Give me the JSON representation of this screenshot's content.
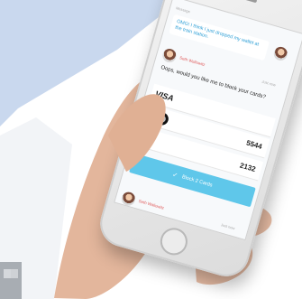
{
  "chat": {
    "user_message": "OMG! I think I just dropped my wallet at the train station.",
    "agent_name": "Seth Wallowitz",
    "agent_time": "Just now",
    "agent_message": "Oops, would you like me to block your cards?",
    "cards": [
      {
        "brand": "VISA",
        "last4": ""
      },
      {
        "brand": "mastercard-icon",
        "last4": "5544"
      },
      {
        "brand": "",
        "last4": "2132"
      }
    ],
    "block_button_label": "Block 2 Cards",
    "footer_agent_name": "Seth Wallowitz",
    "footer_time": "Just now",
    "top_label": "Message"
  },
  "colors": {
    "accent": "#5fc7ea",
    "user_text": "#2e9fd6",
    "agent_name": "#e05c5c",
    "bg_panel": "#c9d8ee"
  }
}
